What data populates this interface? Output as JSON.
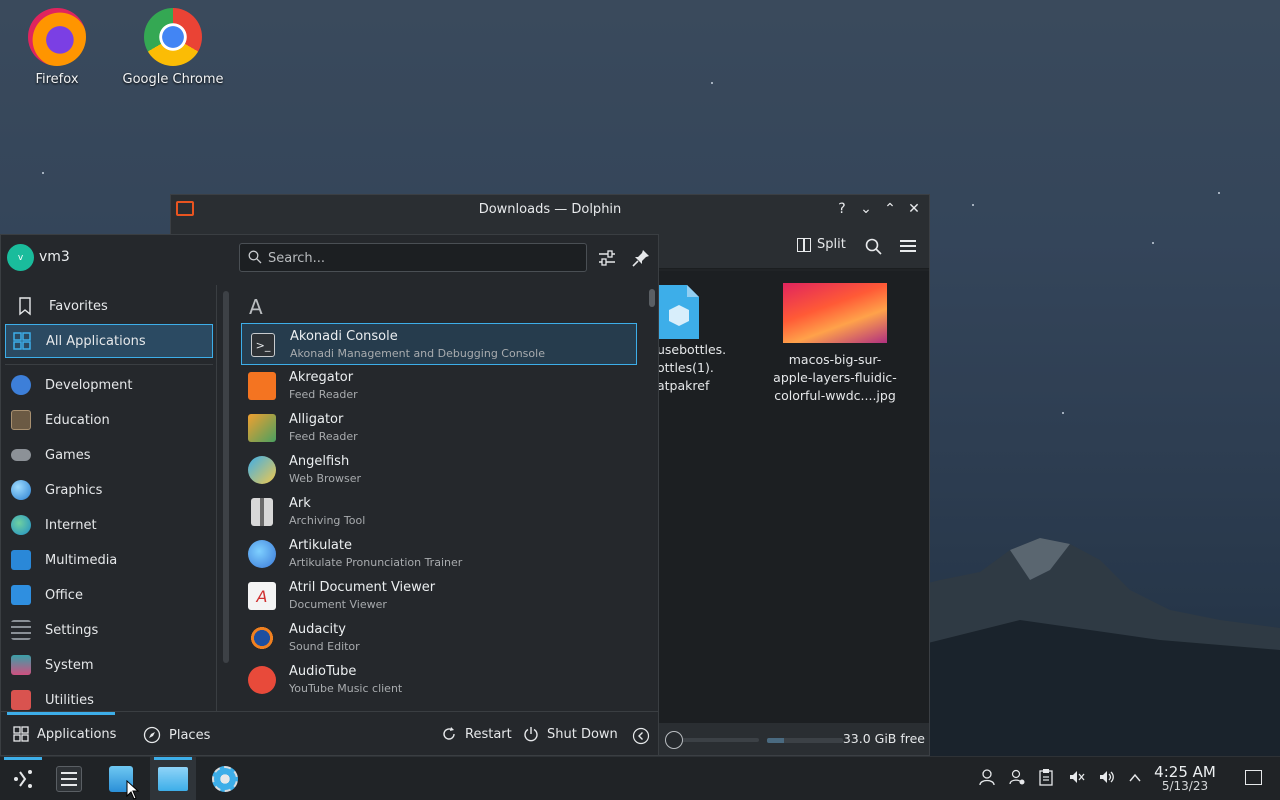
{
  "desktop": {
    "icons": [
      {
        "label": "Firefox",
        "icon": "firefox-icon"
      },
      {
        "label": "Google Chrome",
        "icon": "chrome-icon"
      }
    ]
  },
  "dolphin": {
    "title": "Downloads — Dolphin",
    "title_buttons": [
      "?",
      "⌄",
      "⌃",
      "✕"
    ],
    "toolbar": {
      "split_label": "Split"
    },
    "files": [
      {
        "name_lines": [
          "usebottles.",
          "ottles(1).",
          "atpakref"
        ],
        "icon": "package-icon"
      },
      {
        "name_lines": [
          "macos-big-sur-",
          "apple-layers-fluidic-",
          "colorful-wwdc....jpg"
        ],
        "icon": "image-thumbnail"
      }
    ],
    "status": {
      "free_space": "33.0 GiB free"
    }
  },
  "launcher": {
    "user": {
      "name": "vm3",
      "initial": "v"
    },
    "search": {
      "placeholder": "Search..."
    },
    "categories": [
      {
        "label": "Favorites",
        "icon": "bookmark-icon",
        "color": "#e6e8ea"
      },
      {
        "label": "All Applications",
        "icon": "grid-icon",
        "color": "#3daee9",
        "active": true
      },
      {
        "label": "Development",
        "icon": "development-icon",
        "color": "#3d7fd9"
      },
      {
        "label": "Education",
        "icon": "education-icon",
        "color": "#8a6d4a"
      },
      {
        "label": "Games",
        "icon": "gamepad-icon",
        "color": "#9aa0a6"
      },
      {
        "label": "Graphics",
        "icon": "graphics-icon",
        "color": "#3daee9"
      },
      {
        "label": "Internet",
        "icon": "internet-icon",
        "color": "#2ea7d8"
      },
      {
        "label": "Multimedia",
        "icon": "multimedia-icon",
        "color": "#2a88d8"
      },
      {
        "label": "Office",
        "icon": "office-icon",
        "color": "#2f8fe0"
      },
      {
        "label": "Settings",
        "icon": "settings-icon",
        "color": "#8a9096"
      },
      {
        "label": "System",
        "icon": "system-icon",
        "color": "#3aa0a8"
      },
      {
        "label": "Utilities",
        "icon": "utilities-icon",
        "color": "#d9534f"
      }
    ],
    "section_letter": "A",
    "apps": [
      {
        "name": "Akonadi Console",
        "desc": "Akonadi Management and Debugging Console",
        "color": "#2e3236",
        "icon": "terminal-icon"
      },
      {
        "name": "Akregator",
        "desc": "Feed Reader",
        "color": "#f47421",
        "icon": "rss-icon"
      },
      {
        "name": "Alligator",
        "desc": "Feed Reader",
        "color": "#f0a030",
        "icon": "alligator-icon"
      },
      {
        "name": "Angelfish",
        "desc": "Web Browser",
        "color": "#3daee9",
        "icon": "angelfish-icon"
      },
      {
        "name": "Ark",
        "desc": "Archiving Tool",
        "color": "#d8d8d8",
        "icon": "archive-icon"
      },
      {
        "name": "Artikulate",
        "desc": "Artikulate Pronunciation Trainer",
        "color": "#4aa0e0",
        "icon": "artikulate-icon"
      },
      {
        "name": "Atril Document Viewer",
        "desc": "Document Viewer",
        "color": "#f4f4f4",
        "icon": "document-viewer-icon"
      },
      {
        "name": "Audacity",
        "desc": "Sound Editor",
        "color": "#f08020",
        "icon": "headphones-icon"
      },
      {
        "name": "AudioTube",
        "desc": "YouTube Music client",
        "color": "#e84a3a",
        "icon": "audiotube-icon"
      }
    ],
    "footer": {
      "applications": "Applications",
      "places": "Places",
      "restart": "Restart",
      "shutdown": "Shut Down"
    }
  },
  "taskbar": {
    "clock": {
      "time": "4:25 AM",
      "date": "5/13/23"
    }
  }
}
